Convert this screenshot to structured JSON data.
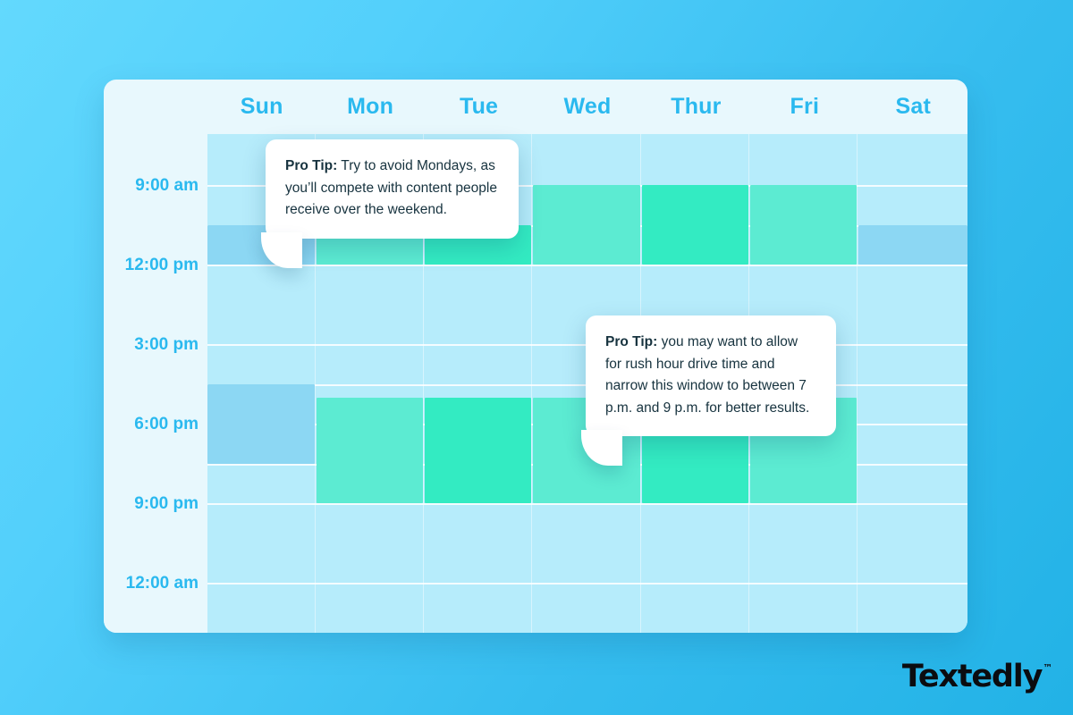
{
  "brand": {
    "name": "Textedly",
    "trademark": "™"
  },
  "calendar": {
    "days": [
      "Sun",
      "Mon",
      "Tue",
      "Wed",
      "Thur",
      "Fri",
      "Sat"
    ],
    "time_labels": [
      "9:00 am",
      "12:00 pm",
      "3:00 pm",
      "6:00 pm",
      "9:00 pm",
      "12:00 am"
    ],
    "colors": {
      "grid_background": "#b6ecfb",
      "card_background": "#e8f8fd",
      "day_label": "#2ab9ef",
      "time_label": "#2ab9ef",
      "block_blue": "#8cd7f3",
      "block_green_light": "#5cebd2",
      "block_green_dark": "#33ebc2",
      "page_gradient_from": "#63d9fd",
      "page_gradient_to": "#22b2e6"
    },
    "blocks": [
      {
        "day": "Sun",
        "period": "late-morning",
        "intensity": "medium",
        "color": "blue"
      },
      {
        "day": "Mon",
        "period": "late-morning",
        "intensity": "high",
        "color": "green-light"
      },
      {
        "day": "Tue",
        "period": "late-morning",
        "intensity": "very-high",
        "color": "green-dark"
      },
      {
        "day": "Wed",
        "period": "morning",
        "intensity": "high",
        "color": "green-light"
      },
      {
        "day": "Thur",
        "period": "morning",
        "intensity": "very-high",
        "color": "green-dark"
      },
      {
        "day": "Fri",
        "period": "morning",
        "intensity": "high",
        "color": "green-light"
      },
      {
        "day": "Sat",
        "period": "late-morning",
        "intensity": "medium",
        "color": "blue"
      },
      {
        "day": "Sun",
        "period": "evening",
        "intensity": "medium",
        "color": "blue"
      },
      {
        "day": "Mon",
        "period": "evening",
        "intensity": "high",
        "color": "green-light"
      },
      {
        "day": "Tue",
        "period": "evening",
        "intensity": "very-high",
        "color": "green-dark"
      },
      {
        "day": "Wed",
        "period": "evening",
        "intensity": "high",
        "color": "green-light"
      },
      {
        "day": "Thur",
        "period": "evening",
        "intensity": "very-high",
        "color": "green-dark"
      },
      {
        "day": "Fri",
        "period": "evening",
        "intensity": "high",
        "color": "green-light"
      }
    ]
  },
  "tooltips": {
    "monday": {
      "label": "Pro Tip:",
      "text": " Try to avoid Mondays, as you’ll compete with content people receive over the weekend."
    },
    "evening": {
      "label": "Pro Tip:",
      "text": " you may want to allow for rush hour drive time and narrow this window to between 7 p.m. and 9 p.m. for better results."
    }
  }
}
